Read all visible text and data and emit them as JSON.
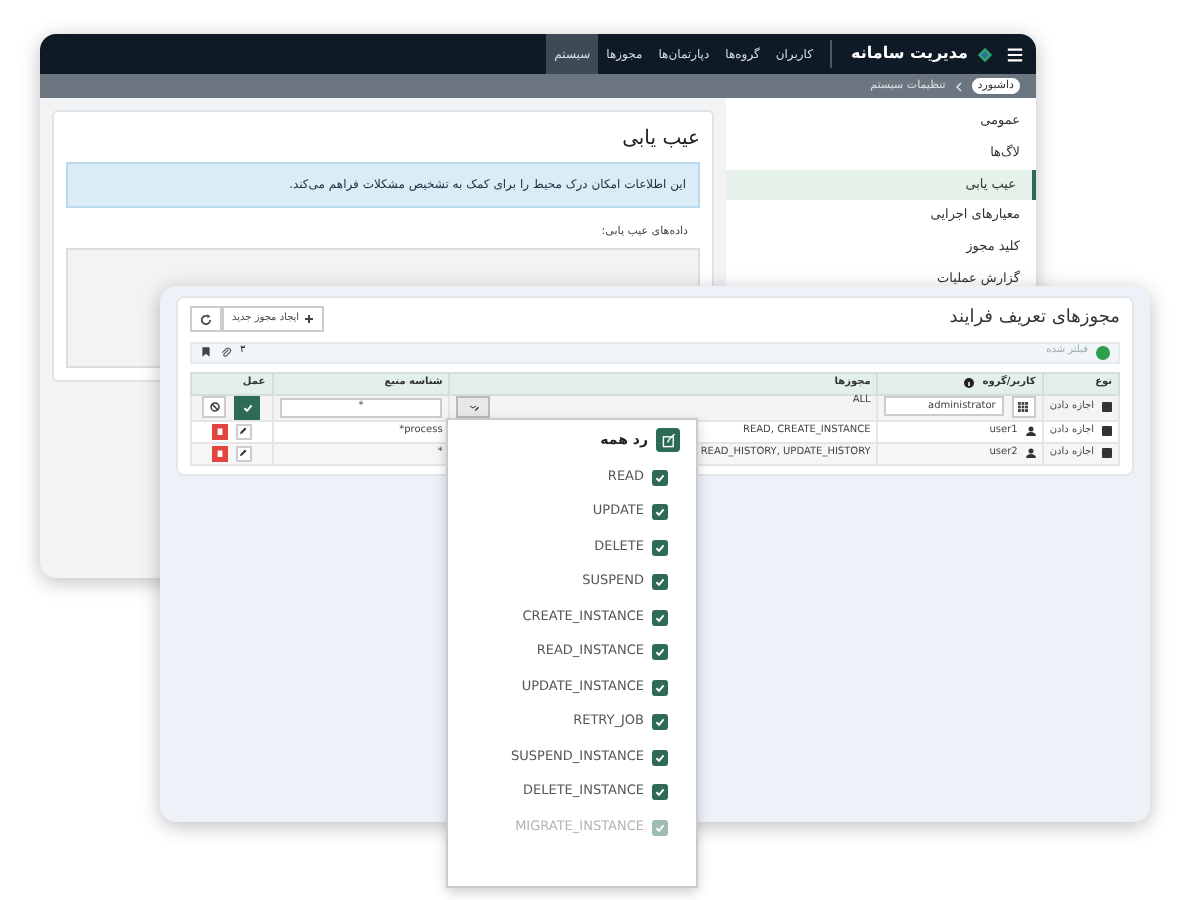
{
  "back_window": {
    "navbar": {
      "brand": "مدیریت سامانه",
      "items": [
        {
          "label": "کاربران",
          "selected": false
        },
        {
          "label": "گروه‌ها",
          "selected": false
        },
        {
          "label": "دپارتمان‌ها",
          "selected": false
        },
        {
          "label": "مجوزها",
          "selected": false
        },
        {
          "label": "سیستم",
          "selected": true
        }
      ]
    },
    "breadcrumb": [
      {
        "label": "داشبورد",
        "kind": "pill"
      },
      {
        "label": "تنظیمات سیستم",
        "kind": "text"
      }
    ],
    "sidebar": {
      "items": [
        {
          "label": "عمومی",
          "selected": false
        },
        {
          "label": "لاگ‌ها",
          "selected": false
        },
        {
          "label": "عیب یابی",
          "selected": true
        },
        {
          "label": "معیارهای اجرایی",
          "selected": false
        },
        {
          "label": "کلید مجوز",
          "selected": false
        },
        {
          "label": "گزارش عملیات",
          "selected": false
        }
      ]
    },
    "content": {
      "title": "عیب یابی",
      "alert": "این اطلاعات امکان درک محیط را برای کمک به تشخیص مشکلات فراهم می‌کند.",
      "label": "داده‌های عیب یابی:"
    }
  },
  "front_window": {
    "title": "مجوزهای تعریف فرایند",
    "create_button": "ایجاد مجوز جدید",
    "status": {
      "label": "فیلتر شده",
      "count": "۳"
    },
    "table": {
      "columns": [
        "نوع",
        "کاربر/گروه",
        "مجوزها",
        "شناسه منبع",
        "عمل"
      ],
      "edit_row": {
        "type": "اجازه دادن",
        "user": "administrator",
        "permissions": "ALL",
        "resource": "*"
      },
      "rows": [
        {
          "type": "اجازه دادن",
          "user": "user1",
          "permissions": "READ, CREATE_INSTANCE",
          "resource": "process*"
        },
        {
          "type": "اجازه دادن",
          "user": "user2",
          "permissions": "READ_HISTORY, UPDATE_HISTORY",
          "resource": "*"
        }
      ]
    },
    "dropdown": {
      "header": "رد همه",
      "items": [
        {
          "label": "READ",
          "checked": true,
          "faded": false
        },
        {
          "label": "UPDATE",
          "checked": true,
          "faded": false
        },
        {
          "label": "DELETE",
          "checked": true,
          "faded": false
        },
        {
          "label": "SUSPEND",
          "checked": true,
          "faded": false
        },
        {
          "label": "CREATE_INSTANCE",
          "checked": true,
          "faded": false
        },
        {
          "label": "READ_INSTANCE",
          "checked": true,
          "faded": false
        },
        {
          "label": "UPDATE_INSTANCE",
          "checked": true,
          "faded": false
        },
        {
          "label": "RETRY_JOB",
          "checked": true,
          "faded": false
        },
        {
          "label": "SUSPEND_INSTANCE",
          "checked": true,
          "faded": false
        },
        {
          "label": "DELETE_INSTANCE",
          "checked": true,
          "faded": false
        },
        {
          "label": "MIGRATE_INSTANCE",
          "checked": true,
          "faded": true
        }
      ]
    }
  }
}
